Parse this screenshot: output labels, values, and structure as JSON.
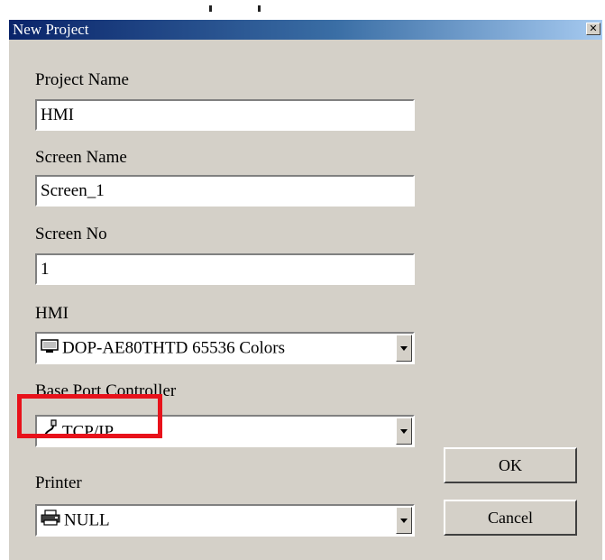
{
  "window": {
    "title": "New Project"
  },
  "fields": {
    "project_name": {
      "label": "Project Name",
      "value": "HMI"
    },
    "screen_name": {
      "label": "Screen Name",
      "value": "Screen_1"
    },
    "screen_no": {
      "label": "Screen No",
      "value": "1"
    },
    "hmi": {
      "label": "HMI",
      "value": "DOP-AE80THTD 65536 Colors",
      "icon": "monitor-icon"
    },
    "base_port_controller": {
      "label": "Base Port Controller",
      "value": "TCP/IP",
      "icon": "network-cable-icon"
    },
    "printer": {
      "label": "Printer",
      "value": "NULL",
      "icon": "printer-icon"
    }
  },
  "buttons": {
    "ok": "OK",
    "cancel": "Cancel"
  },
  "annotation": {
    "highlight_color": "#e8121b"
  }
}
